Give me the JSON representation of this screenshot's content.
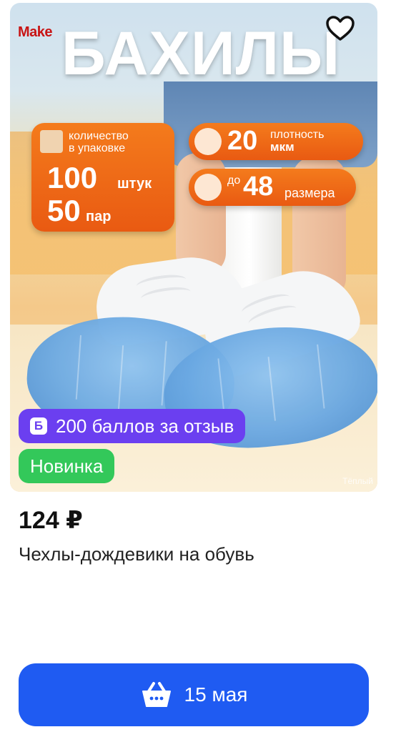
{
  "image": {
    "logo": "Make",
    "headline": "БАХИЛЫ",
    "quantity_label_1": "количество",
    "quantity_label_2": "в упаковке",
    "quantity_pieces": "100",
    "quantity_pieces_unit": "штук",
    "quantity_pairs": "50",
    "quantity_pairs_unit": "пар",
    "density_value": "20",
    "density_unit": "мкм",
    "density_label": "плотность",
    "size_prefix": "до",
    "size_value": "48",
    "size_unit": "размера",
    "watermark": "Тёплый"
  },
  "badges": {
    "points_icon": "Б",
    "points_text": "200 баллов за отзыв",
    "new_text": "Новинка"
  },
  "product": {
    "price": "124 ₽",
    "title": "Чехлы-дождевики на обувь"
  },
  "cart_button": {
    "label": "15 мая",
    "icon": "basket-icon"
  },
  "colors": {
    "button": "#1f5bf2",
    "points_badge": "#6b3ff0",
    "new_badge": "#33c85a",
    "panel": "#ee6a16"
  }
}
